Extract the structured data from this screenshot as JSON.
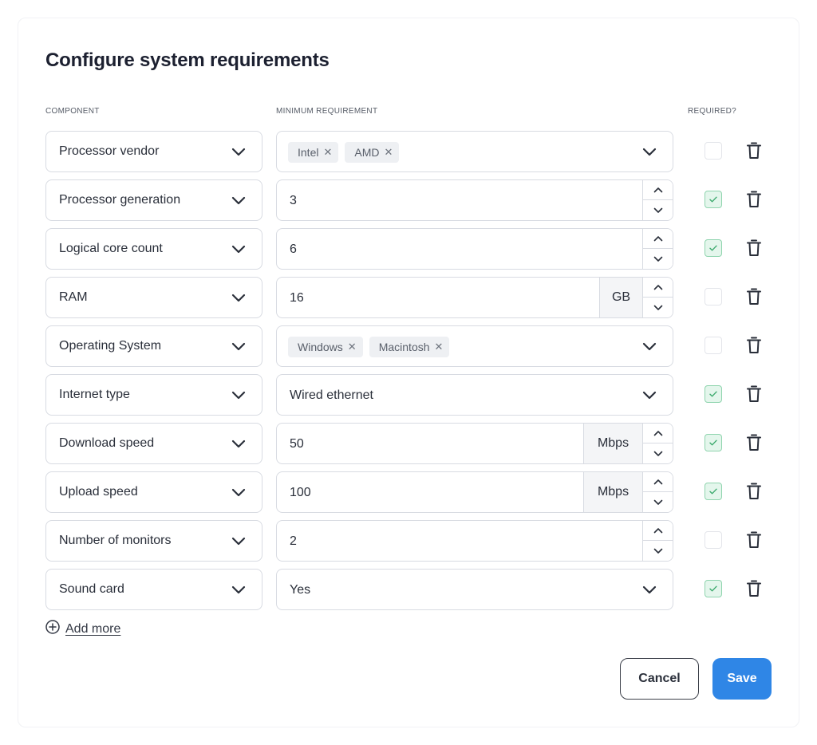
{
  "title": "Configure system requirements",
  "columns": {
    "component": "COMPONENT",
    "minimum": "MINIMUM REQUIREMENT",
    "required": "REQUIRED?"
  },
  "rows": [
    {
      "component": "Processor vendor",
      "kind": "multiselect",
      "tags": [
        "Intel",
        "AMD"
      ],
      "required": false
    },
    {
      "component": "Processor generation",
      "kind": "number",
      "value": "3",
      "required": true
    },
    {
      "component": "Logical core count",
      "kind": "number",
      "value": "6",
      "required": true
    },
    {
      "component": "RAM",
      "kind": "number-unit",
      "value": "16",
      "unit": "GB",
      "required": false
    },
    {
      "component": "Operating System",
      "kind": "multiselect",
      "tags": [
        "Windows",
        "Macintosh"
      ],
      "required": false
    },
    {
      "component": "Internet type",
      "kind": "select",
      "value": "Wired ethernet",
      "required": true
    },
    {
      "component": "Download speed",
      "kind": "number-unit",
      "value": "50",
      "unit": "Mbps",
      "required": true
    },
    {
      "component": "Upload speed",
      "kind": "number-unit",
      "value": "100",
      "unit": "Mbps",
      "required": true
    },
    {
      "component": "Number of monitors",
      "kind": "number",
      "value": "2",
      "required": false
    },
    {
      "component": "Sound card",
      "kind": "select",
      "value": "Yes",
      "required": true
    }
  ],
  "add_more_label": "Add more",
  "buttons": {
    "cancel": "Cancel",
    "save": "Save"
  },
  "colors": {
    "accent": "#2f86e6",
    "check_bg": "#e4f6ec",
    "check_border": "#8fd4ae",
    "check_mark": "#3daa6e"
  }
}
